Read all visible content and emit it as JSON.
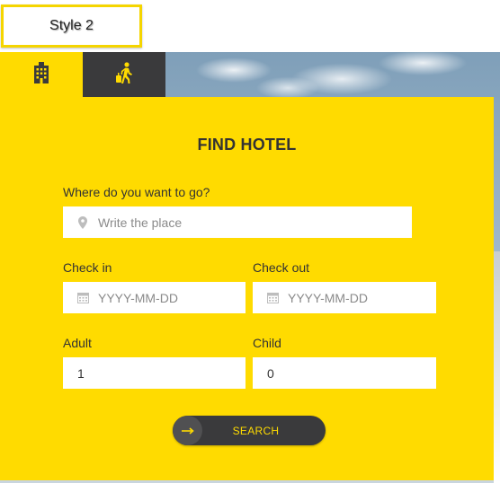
{
  "header": {
    "style_label": "Style 2"
  },
  "tabs": [
    {
      "icon": "hotel-building-icon",
      "active": true
    },
    {
      "icon": "traveler-luggage-icon",
      "active": false
    }
  ],
  "form": {
    "title": "FIND HOTEL",
    "destination": {
      "label": "Where do you want to go?",
      "placeholder": "Write the place",
      "icon": "map-marker-icon"
    },
    "check_in": {
      "label": "Check in",
      "placeholder": "YYYY-MM-DD",
      "icon": "calendar-icon"
    },
    "check_out": {
      "label": "Check out",
      "placeholder": "YYYY-MM-DD",
      "icon": "calendar-icon"
    },
    "adult": {
      "label": "Adult",
      "value": "1"
    },
    "child": {
      "label": "Child",
      "value": "0"
    },
    "search_button": {
      "label": "SEARCH",
      "icon": "arrow-right-icon"
    }
  },
  "colors": {
    "accent": "#ffdb00",
    "dark": "#3a3a3c",
    "text": "#333333",
    "placeholder": "#8a8a8a"
  }
}
